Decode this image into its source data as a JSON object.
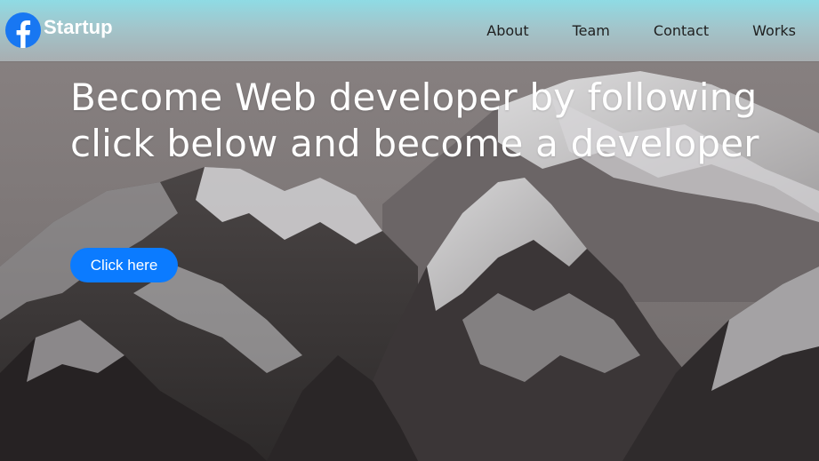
{
  "navbar": {
    "brand": {
      "name": "Startup",
      "logo_icon": "facebook-icon",
      "logo_color": "#1877f2"
    },
    "links": [
      {
        "label": "About"
      },
      {
        "label": "Team"
      },
      {
        "label": "Contact"
      },
      {
        "label": "Works"
      }
    ],
    "gradient_top": "#8fdbe4"
  },
  "hero": {
    "title": "Become Web developer by following click below and become a developer",
    "cta_label": "Click here",
    "cta_color": "#0b7bff",
    "background": "snowy-mountains-image"
  }
}
